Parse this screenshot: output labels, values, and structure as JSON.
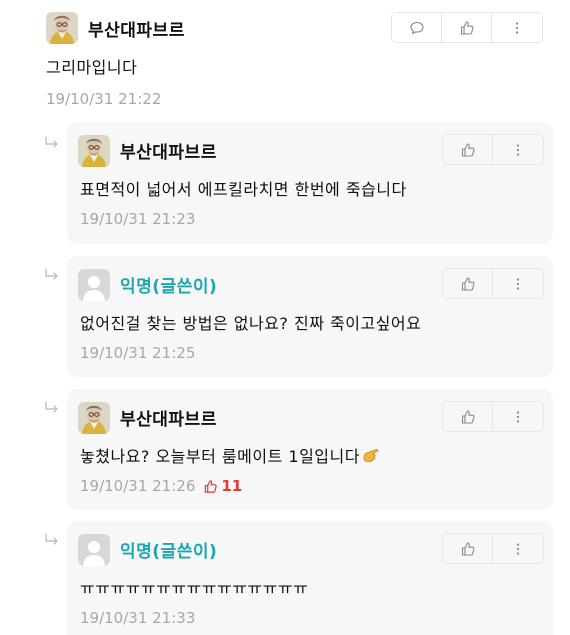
{
  "parent": {
    "author": "부산대파브르",
    "content": "그리마입니다",
    "time": "19/10/31 21:22"
  },
  "replies": [
    {
      "author": "부산대파브르",
      "content": "표면적이 넓어서 에프킬라치면 한번에 죽습니다",
      "time": "19/10/31 21:23",
      "anonymous": false
    },
    {
      "author": "익명(글쓴이)",
      "content": "없어진걸 찾는 방법은 없나요? 진짜 죽이고싶어요",
      "time": "19/10/31 21:25",
      "anonymous": true
    },
    {
      "author": "부산대파브르",
      "content": "놓쳤나요? 오늘부터 룸메이트 1일입니다",
      "time": "19/10/31 21:26",
      "vote_count": "11",
      "anonymous": false
    },
    {
      "author": "익명(글쓴이)",
      "content": "ㅠㅠㅠㅠㅠㅠㅠㅠㅠㅠㅠㅠㅠㅠㅠ",
      "time": "19/10/31 21:33",
      "anonymous": true
    }
  ],
  "icons": {
    "comment": "speech-bubble-icon",
    "like": "thumbs-up-icon",
    "more": "vertical-ellipsis-icon",
    "reply_arrow": "reply-arrow-icon",
    "emoji": "pointing-hand-emoji"
  },
  "colors": {
    "anonymous_name": "#1aa7b0",
    "vote": "#e53935",
    "time": "#a7a7a7",
    "reply_bg": "#f7f7f7"
  }
}
